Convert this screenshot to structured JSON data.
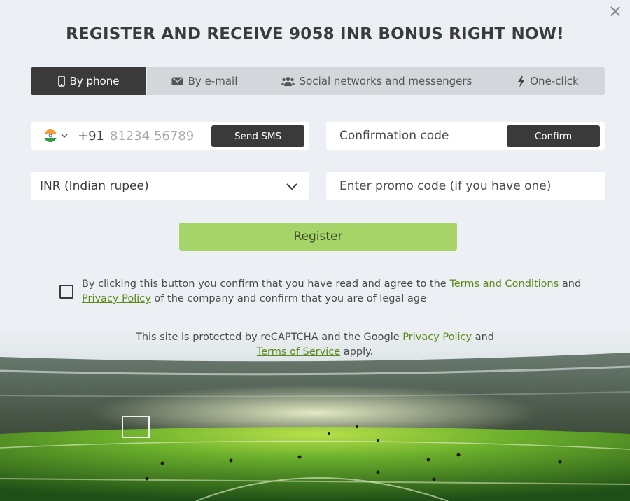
{
  "title": "REGISTER AND RECEIVE 9058 INR BONUS RIGHT NOW!",
  "tabs": [
    {
      "label": "By phone",
      "icon": "phone-icon",
      "active": true
    },
    {
      "label": "By e-mail",
      "icon": "envelope-icon",
      "active": false
    },
    {
      "label": "Social networks and messengers",
      "icon": "users-icon",
      "active": false
    },
    {
      "label": "One-click",
      "icon": "lightning-icon",
      "active": false
    }
  ],
  "phone": {
    "country_code": "+91",
    "placeholder": "81234 56789",
    "send_sms_label": "Send SMS"
  },
  "confirmation": {
    "placeholder": "Confirmation code",
    "confirm_label": "Confirm"
  },
  "currency": {
    "selected": "INR (Indian rupee)"
  },
  "promo": {
    "placeholder": "Enter promo code (if you have one)"
  },
  "register_label": "Register",
  "agreement": {
    "text_before": "By clicking this button you confirm that you have read and agree to the ",
    "terms_link": "Terms and Conditions",
    "and": " and ",
    "privacy_link": "Privacy Policy",
    "text_after": " of the company and confirm that you are of legal age"
  },
  "recaptcha": {
    "text_before": "This site is protected by reCAPTCHA and the Google ",
    "privacy_link": "Privacy Policy",
    "and": " and ",
    "terms_link": "Terms of Service",
    "text_after": " apply."
  },
  "colors": {
    "accent_green": "#a6d468",
    "link_green": "#5c8a1d",
    "dark": "#3a3a3a",
    "background": "#eceff3"
  }
}
